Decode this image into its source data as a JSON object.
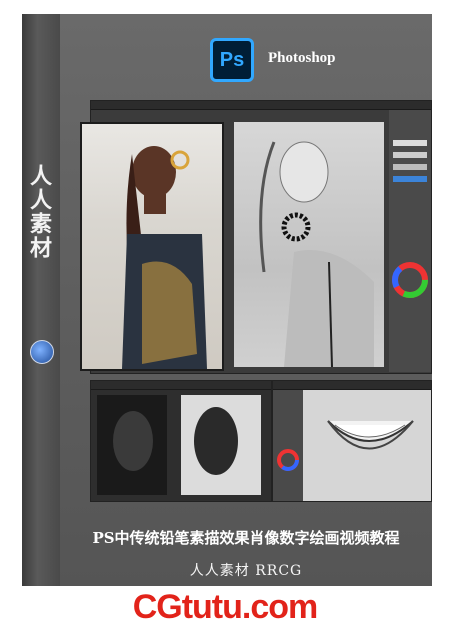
{
  "spine": {
    "title": "人人素材"
  },
  "front": {
    "logo_text": "Ps",
    "app_name": "Photoshop",
    "course_title": "PS中传统铅笔素描效果肖像数字绘画视频教程",
    "brand_line": "人人素材  RRCG"
  },
  "footer": {
    "brand": "CGtutu.com"
  },
  "colors": {
    "ps_blue": "#31a8ff",
    "ps_dark": "#001e36",
    "footer_red": "#e2231a",
    "box_gray": "#5e5e5e"
  }
}
